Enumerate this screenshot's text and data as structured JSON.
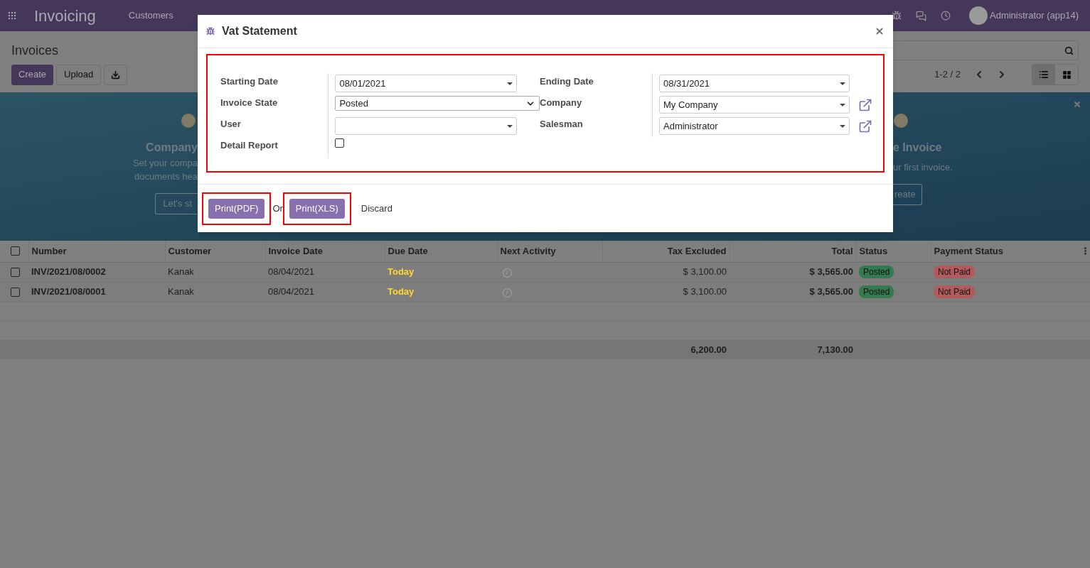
{
  "navbar": {
    "app_title": "Invoicing",
    "menu": [
      "Customers"
    ],
    "user": "Administrator (app14)"
  },
  "control_panel": {
    "title": "Invoices",
    "buttons": [
      "Create",
      "Upload"
    ],
    "pager": "1-2 / 2",
    "views": [
      {
        "kind": "list",
        "selected": true
      },
      {
        "kind": "kanban",
        "selected": false
      }
    ]
  },
  "banner": {
    "left": {
      "title": "Company",
      "lines": [
        "Set your compa",
        "documents hea"
      ],
      "button": "Let's st"
    },
    "right": {
      "title": "e Invoice",
      "lines": [
        "ur first invoice."
      ],
      "button": "reate"
    }
  },
  "table": {
    "columns": [
      "Number",
      "Customer",
      "Invoice Date",
      "Due Date",
      "Next Activity",
      "Tax Excluded",
      "Total",
      "Status",
      "Payment Status"
    ],
    "all_checked": false,
    "rows": [
      {
        "checked": false,
        "number": "INV/2021/08/0002",
        "customer": "Kanak",
        "invoice_date": "08/04/2021",
        "due_date": "Today",
        "tax_excluded": "$ 3,100.00",
        "total": "$ 3,565.00",
        "status": "Posted",
        "payment_status": "Not Paid"
      },
      {
        "checked": false,
        "number": "INV/2021/08/0001",
        "customer": "Kanak",
        "invoice_date": "08/04/2021",
        "due_date": "Today",
        "tax_excluded": "$ 3,100.00",
        "total": "$ 3,565.00",
        "status": "Posted",
        "payment_status": "Not Paid"
      }
    ],
    "totals": {
      "tax_excluded": "6,200.00",
      "total": "7,130.00"
    }
  },
  "dialog": {
    "title": "Vat Statement",
    "left_fields": [
      {
        "label": "Starting Date",
        "kind": "dropdown",
        "value": "08/01/2021"
      },
      {
        "label": "Invoice State",
        "kind": "select",
        "value": "Posted"
      },
      {
        "label": "User",
        "kind": "dropdown",
        "external_link": false
      },
      {
        "label": "Detail Report",
        "kind": "checkbox",
        "checked": false
      }
    ],
    "right_fields": [
      {
        "label": "Ending Date",
        "kind": "dropdown",
        "value": "08/31/2021"
      },
      {
        "label": "Company",
        "kind": "dropdown",
        "value": "My Company",
        "external_link": true
      },
      {
        "label": "Salesman",
        "kind": "dropdown",
        "value": "Administrator",
        "external_link": true
      }
    ],
    "buttons": [
      "Print(PDF)",
      "Print(XLS)"
    ],
    "separator": "Or",
    "discard": "Discard"
  }
}
